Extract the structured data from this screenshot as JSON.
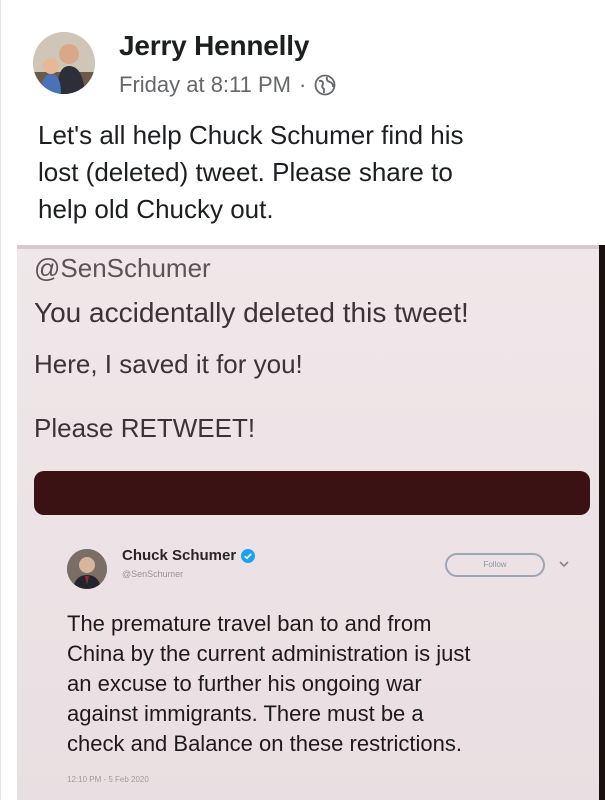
{
  "post": {
    "author": "Jerry Hennelly",
    "time": "Friday at 8:11 PM",
    "meta_separator": "·",
    "text_lines": [
      "Let's all help Chuck Schumer find his",
      "lost (deleted) tweet.  Please share to",
      "help old Chucky out."
    ]
  },
  "meme": {
    "handle": "@SenSchumer",
    "line1": "You accidentally deleted this tweet!",
    "line2": "Here, I saved it for you!",
    "line3": "Please RETWEET!",
    "tweet": {
      "name": "Chuck Schumer",
      "handle": "@SenSchumer",
      "follow_label": "Follow",
      "body_lines": [
        "The premature travel ban to and from",
        "China by the current administration is just",
        "an excuse to further his ongoing war",
        "against immigrants. There must be a",
        "check and Balance on these restrictions."
      ],
      "timestamp": "12:10 PM - 5 Feb 2020"
    }
  },
  "colors": {
    "name_text": "#1c1e21",
    "meta_text": "#65676b",
    "verified_blue": "#1da1f2",
    "dark_bar": "#3a1214"
  }
}
